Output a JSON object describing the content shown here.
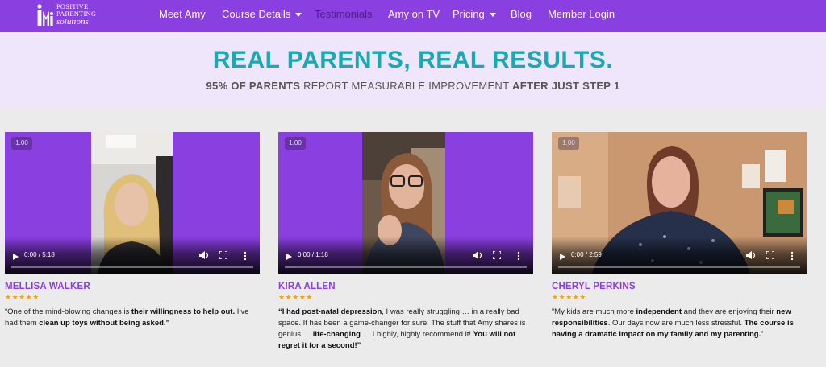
{
  "logo": {
    "line1": "Positive",
    "line2": "Parenting",
    "line3": "solutions"
  },
  "nav": [
    {
      "label": "Meet Amy",
      "has_caret": false,
      "active": false
    },
    {
      "label": "Course Details",
      "has_caret": true,
      "active": false
    },
    {
      "label": "Testimonials",
      "has_caret": false,
      "active": true
    },
    {
      "label": "Amy on TV",
      "has_caret": false,
      "active": false
    },
    {
      "label": "Pricing",
      "has_caret": true,
      "active": false
    },
    {
      "label": "Blog",
      "has_caret": false,
      "active": false
    },
    {
      "label": "Member Login",
      "has_caret": false,
      "active": false
    }
  ],
  "hero": {
    "title": "REAL PARENTS, REAL RESULTS.",
    "sub_b1": "95% OF PARENTS",
    "sub_mid": " REPORT MEASURABLE IMPROVEMENT ",
    "sub_b2": "AFTER JUST STEP 1"
  },
  "testimonials": [
    {
      "speed": "1.00",
      "time": "0:00 / 5:18",
      "name": "MELLISA WALKER",
      "stars": "★★★★★",
      "quote": [
        {
          "t": "“One of the mind-blowing changes is ",
          "b": false
        },
        {
          "t": "their willingness to help out.",
          "b": true
        },
        {
          "t": " I’ve had them ",
          "b": false
        },
        {
          "t": "clean up toys without being asked.”",
          "b": true
        }
      ]
    },
    {
      "speed": "1.00",
      "time": "0:00 / 1:18",
      "name": "KIRA ALLEN",
      "stars": "★★★★★",
      "quote": [
        {
          "t": "“I had post-natal depression",
          "b": true
        },
        {
          "t": ", I was really struggling … in a really bad space. It has been a game-changer for sure. The stuff that Amy shares is genius … ",
          "b": false
        },
        {
          "t": "life-changing",
          "b": true
        },
        {
          "t": " … I highly, highly recommend it! ",
          "b": false
        },
        {
          "t": "You will not regret it for a second!”",
          "b": true
        }
      ]
    },
    {
      "speed": "1.00",
      "time": "0:00 / 2:59",
      "name": "CHERYL PERKINS",
      "stars": "★★★★★",
      "quote": [
        {
          "t": "“My kids are much more ",
          "b": false
        },
        {
          "t": "independent",
          "b": true
        },
        {
          "t": " and they are enjoying their ",
          "b": false
        },
        {
          "t": "new responsibilities",
          "b": true
        },
        {
          "t": ". Our days now are much less stressful. ",
          "b": false
        },
        {
          "t": "The course is having a dramatic impact on my family and my parenting.",
          "b": true
        },
        {
          "t": "”",
          "b": false
        }
      ]
    }
  ]
}
